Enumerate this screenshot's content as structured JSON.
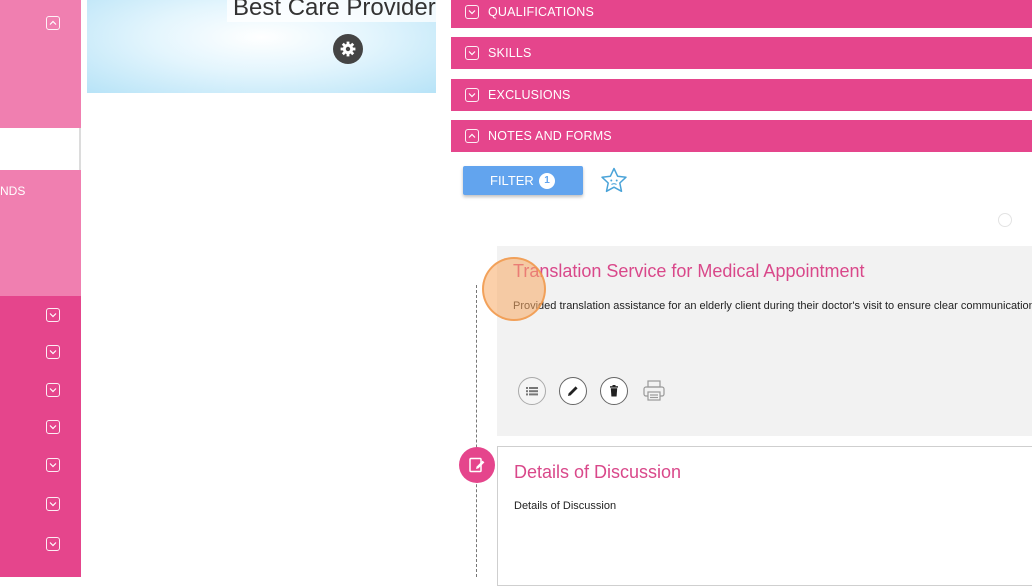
{
  "sidebar": {
    "partial_label": "NDS",
    "chevron_rows": 7
  },
  "banner": {
    "title": "Best Care Provider"
  },
  "sections": [
    {
      "label": "QUALIFICATIONS",
      "state": "collapsed"
    },
    {
      "label": "SKILLS",
      "state": "collapsed"
    },
    {
      "label": "EXCLUSIONS",
      "state": "collapsed"
    },
    {
      "label": "NOTES AND FORMS",
      "state": "expanded"
    }
  ],
  "filter": {
    "label": "FILTER",
    "count": "1"
  },
  "notes": [
    {
      "title": "Translation Service for Medical Appointment",
      "body": "Provided translation assistance for an elderly client during their doctor's visit to ensure clear communication"
    },
    {
      "title": "Details of Discussion",
      "body": "Details of Discussion"
    }
  ],
  "colors": {
    "primary": "#e5458c",
    "sidebar_light": "#f07fb0",
    "filter": "#62a4ee",
    "card_title": "#d9488a"
  },
  "icons": [
    "settings-gear-icon",
    "chevron-up-icon",
    "chevron-down-icon",
    "star-favorite-icon",
    "list-icon",
    "edit-pencil-icon",
    "trash-icon",
    "printer-icon",
    "note-edit-icon"
  ]
}
